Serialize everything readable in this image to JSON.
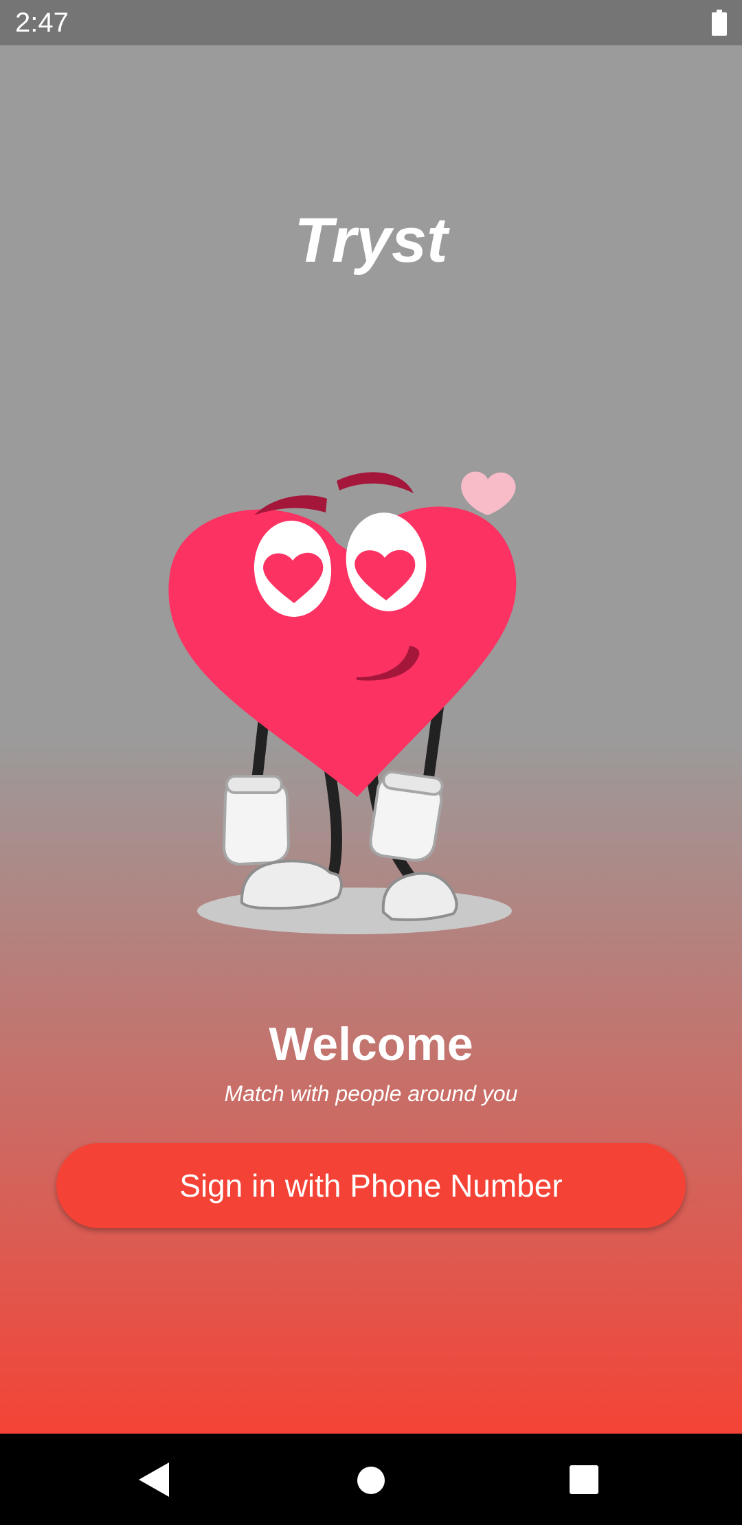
{
  "status_bar": {
    "time": "2:47",
    "icons": [
      "battery-icon"
    ]
  },
  "app": {
    "title": "Tryst"
  },
  "illustration": {
    "icon": "heart-mascot-icon",
    "colors": {
      "heart": "#fb3262",
      "accent": "#a5163b",
      "small_heart": "#f8bcc9"
    }
  },
  "welcome": {
    "title": "Welcome",
    "subtitle": "Match with people around you"
  },
  "signin_button": {
    "label": "Sign in with Phone Number",
    "color": "#f44336"
  },
  "nav_bar": {
    "icons": [
      "back-icon",
      "home-icon",
      "recent-apps-icon"
    ]
  },
  "theme": {
    "gradient_top": "#9b9b9b",
    "gradient_bottom": "#f44336",
    "text": "#ffffff"
  }
}
